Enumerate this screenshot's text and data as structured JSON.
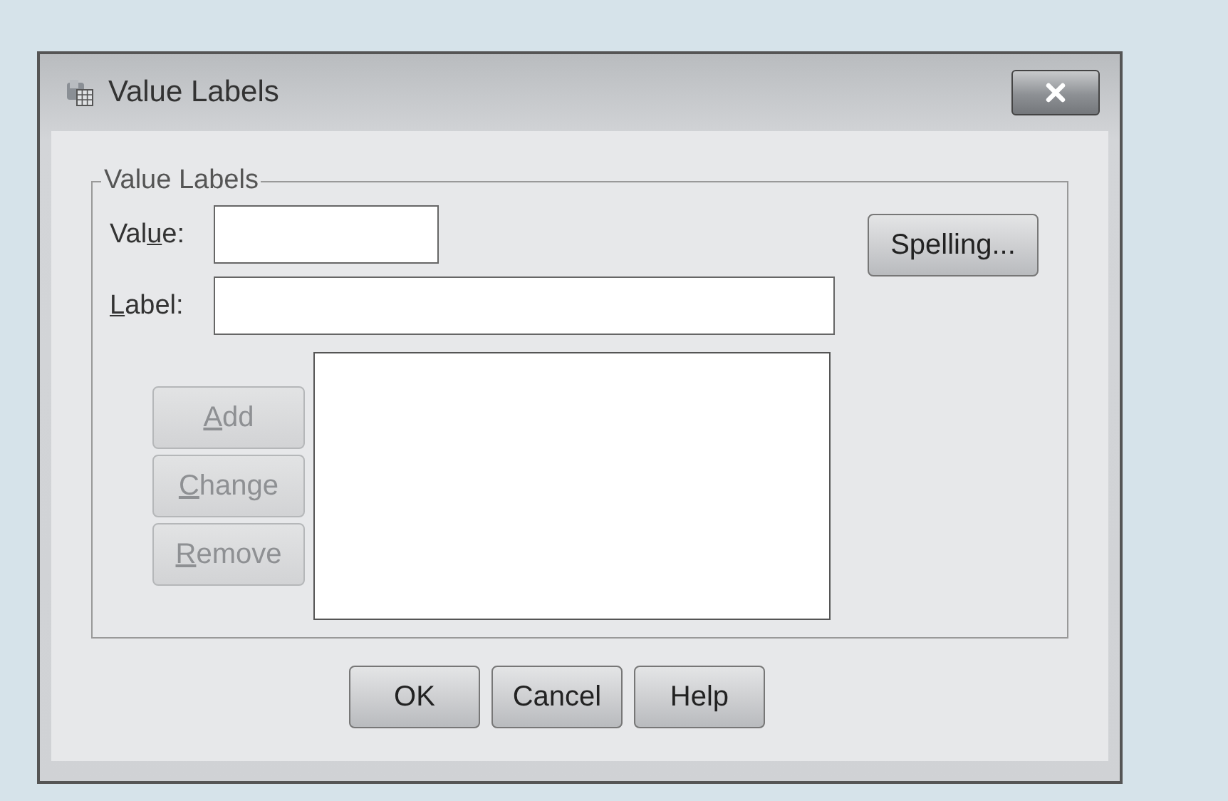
{
  "window": {
    "title": "Value Labels"
  },
  "group": {
    "title": "Value Labels"
  },
  "fields": [
    {
      "kind": "short",
      "label": {
        "pre": "Val",
        "key": "u",
        "post": "e:"
      }
    },
    {
      "kind": "long",
      "label": {
        "key": "L",
        "post": "abel:"
      }
    }
  ],
  "side_button": {
    "label": "Spelling...",
    "disabled": false
  },
  "list_buttons": [
    {
      "label": {
        "key": "A",
        "post": "dd"
      },
      "disabled": true
    },
    {
      "label": {
        "key": "C",
        "post": "hange"
      },
      "disabled": true
    },
    {
      "label": {
        "key": "R",
        "post": "emove"
      },
      "disabled": true
    }
  ],
  "buttons": [
    {
      "label": "OK",
      "disabled": false
    },
    {
      "label": "Cancel",
      "disabled": false
    },
    {
      "label": "Help",
      "disabled": false
    }
  ]
}
